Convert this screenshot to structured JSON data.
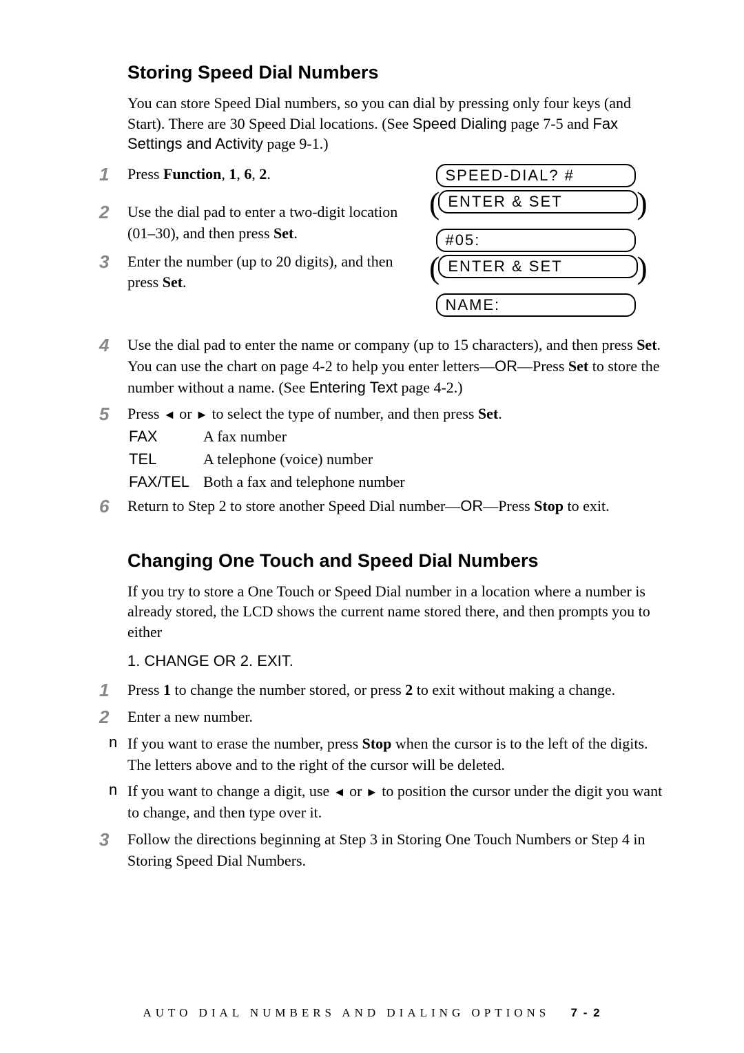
{
  "section1": {
    "heading": "Storing Speed Dial Numbers",
    "intro_seg1": "You can store Speed Dial numbers, so you can dial by pressing only four keys (and Start). There are 30 Speed Dial locations. (See ",
    "intro_ref1": "Speed Dialing",
    "intro_seg2": " page 7-5 and ",
    "intro_ref2": "Fax Settings and Activity",
    "intro_seg3": " page 9-1.)",
    "steps": [
      {
        "num": "1",
        "html": "Press <b>Function</b>, <b>1</b>, <b>6</b>, <b>2</b>."
      },
      {
        "num": "2",
        "html": "Use the dial pad to enter a two-digit location (01–30), and then press <b>Set</b>."
      },
      {
        "num": "3",
        "html": "Enter the number (up to 20 digits), and then press <b>Set</b>."
      },
      {
        "num": "4",
        "html": "Use the dial pad to enter the name or company (up to 15 characters), and then press <b>Set</b>. You can use the chart on page 4-2 to help you enter letters—<span class=\"sans\">OR</span>—Press <b>Set</b> to store the number without a name. (See <span class=\"sans\">Entering Text</span> page 4-2.)"
      },
      {
        "num": "5",
        "html": "Press <span class=\"arrow\">◄</span> or <span class=\"arrow\">►</span> to select the type of number, and then press <b>Set</b>."
      },
      {
        "num": "6",
        "html": "Return to Step 2 to store another Speed Dial number—<span class=\"sans\">OR</span>—Press <b>Stop</b> to exit."
      }
    ],
    "table": [
      {
        "label": "FAX",
        "text": "A fax number"
      },
      {
        "label": "TEL",
        "text": "A telephone (voice) number"
      },
      {
        "label": "FAX/TEL",
        "text": "Both a fax and telephone number"
      }
    ],
    "lcd": {
      "line1": "SPEED-DIAL? #",
      "line2": "ENTER & SET",
      "line3": "#05:",
      "line4": "ENTER & SET",
      "line5": "NAME:"
    }
  },
  "section2": {
    "heading": "Changing One Touch and Speed Dial Numbers",
    "intro": "If you try to store a One Touch or Speed Dial number in a location where a number is already stored, the LCD shows the current name stored there, and then prompts you to either",
    "lcdtext": "1. CHANGE OR 2. EXIT.",
    "steps": [
      {
        "num": "1",
        "html": "Press <b>1</b> to change the number stored, or press <b>2</b> to exit without making a change."
      },
      {
        "num": "2",
        "html": "Enter a new number."
      }
    ],
    "bullets": [
      {
        "html": "If you want to erase the number, press <b>Stop</b> when the cursor is to the left of the digits. The letters above and to the right of the cursor will be deleted."
      },
      {
        "html": "If you want to change a digit, use <span class=\"arrow\">◄</span> or <span class=\"arrow\">►</span> to position the cursor under the digit you want to change, and then type over it."
      }
    ],
    "step3": {
      "num": "3",
      "html": "Follow the directions beginning at Step 3 in Storing One Touch Numbers or Step 4 in Storing Speed Dial Numbers."
    }
  },
  "footer": {
    "title": "AUTO DIAL NUMBERS AND DIALING OPTIONS",
    "page": "7 - 2"
  }
}
